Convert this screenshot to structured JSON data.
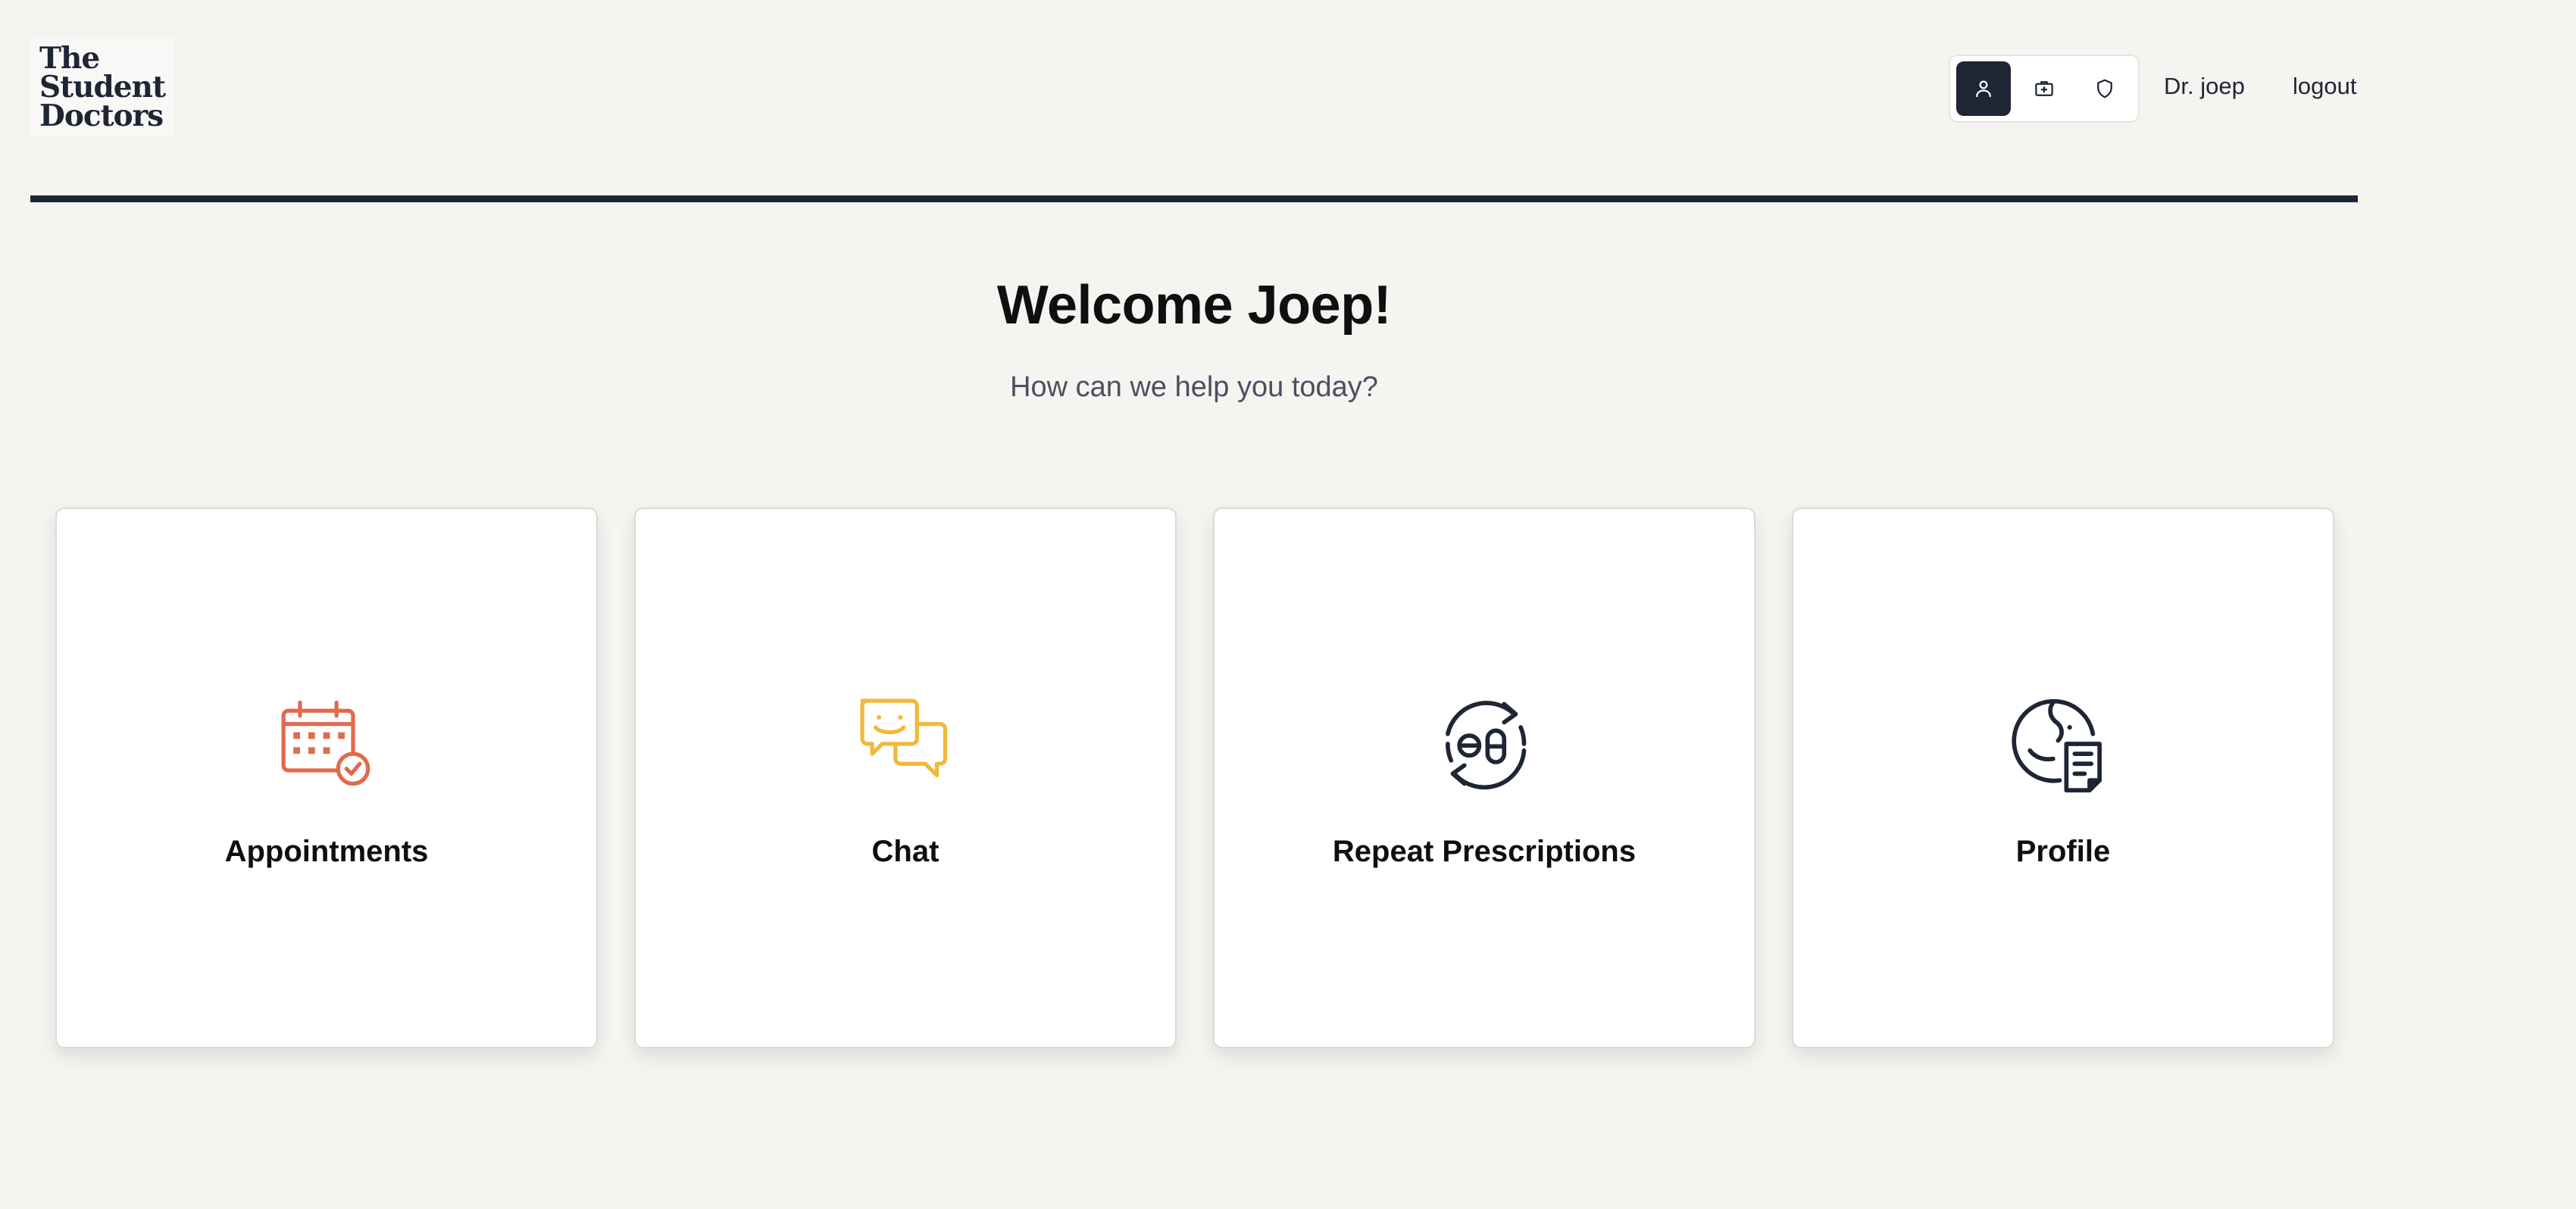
{
  "brand": {
    "logo_lines": [
      "The",
      "Student",
      "Doctors"
    ]
  },
  "header": {
    "role_buttons": [
      {
        "icon": "person-icon",
        "active": true
      },
      {
        "icon": "medical-bag-icon",
        "active": false
      },
      {
        "icon": "shield-icon",
        "active": false
      }
    ],
    "user_name": "Dr. joep",
    "logout_label": "logout"
  },
  "main": {
    "title": "Welcome Joep!",
    "subtitle": "How can we help you today?",
    "cards": [
      {
        "label": "Appointments",
        "icon": "calendar-check-icon",
        "color": "#e06a4e"
      },
      {
        "label": "Chat",
        "icon": "chat-bubbles-icon",
        "color": "#f0b93a"
      },
      {
        "label": "Repeat Prescriptions",
        "icon": "pill-refresh-icon",
        "color": "#1e2535"
      },
      {
        "label": "Profile",
        "icon": "face-document-icon",
        "color": "#1e2535"
      }
    ]
  },
  "colors": {
    "background": "#f5f4f1",
    "primary": "#1e2535",
    "accent_appointments": "#e06a4e",
    "accent_chat": "#f0b93a"
  }
}
